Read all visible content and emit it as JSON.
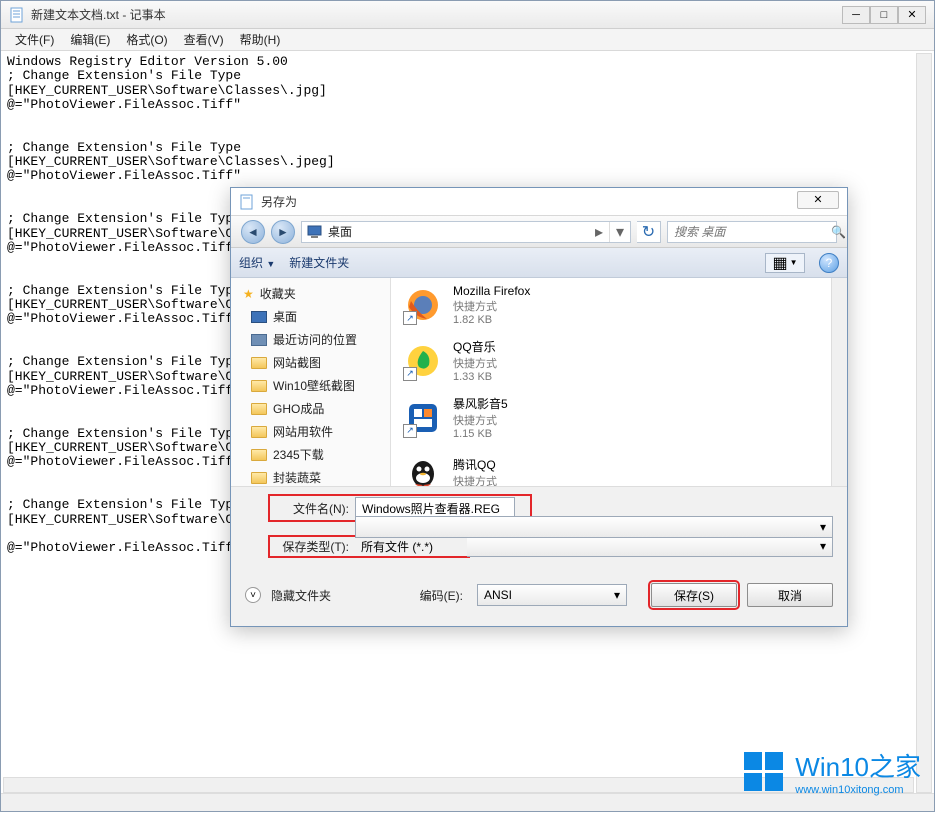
{
  "notepad": {
    "title": "新建文本文档.txt - 记事本",
    "menu": {
      "file": "文件(F)",
      "edit": "编辑(E)",
      "format": "格式(O)",
      "view": "查看(V)",
      "help": "帮助(H)"
    },
    "content": "Windows Registry Editor Version 5.00\n; Change Extension's File Type\n[HKEY_CURRENT_USER\\Software\\Classes\\.jpg]\n@=\"PhotoViewer.FileAssoc.Tiff\"\n\n\n; Change Extension's File Type\n[HKEY_CURRENT_USER\\Software\\Classes\\.jpeg]\n@=\"PhotoViewer.FileAssoc.Tiff\"\n\n\n; Change Extension's File Type\n[HKEY_CURRENT_USER\\Software\\C\n@=\"PhotoViewer.FileAssoc.Tiff\n\n\n; Change Extension's File Type\n[HKEY_CURRENT_USER\\Software\\C\n@=\"PhotoViewer.FileAssoc.Tiff\n\n\n; Change Extension's File Type\n[HKEY_CURRENT_USER\\Software\\C\n@=\"PhotoViewer.FileAssoc.Tiff\n\n\n; Change Extension's File Type\n[HKEY_CURRENT_USER\\Software\\C\n@=\"PhotoViewer.FileAssoc.Tiff\n\n\n; Change Extension's File Type\n[HKEY_CURRENT_USER\\Software\\C\n\n@=\"PhotoViewer.FileAssoc.Tiff"
  },
  "dialog": {
    "title": "另存为",
    "location": "桌面",
    "search_placeholder": "搜索 桌面",
    "organize": "组织",
    "new_folder": "新建文件夹",
    "sidebar": {
      "favorites": "收藏夹",
      "items": [
        "桌面",
        "最近访问的位置",
        "网站截图",
        "Win10壁纸截图",
        "GHO成品",
        "网站用软件",
        "2345下载",
        "封装蔬菜"
      ]
    },
    "files": [
      {
        "name": "Mozilla Firefox",
        "type": "快捷方式",
        "size": "1.82 KB",
        "icon": "firefox"
      },
      {
        "name": "QQ音乐",
        "type": "快捷方式",
        "size": "1.33 KB",
        "icon": "qqmusic"
      },
      {
        "name": "暴风影音5",
        "type": "快捷方式",
        "size": "1.15 KB",
        "icon": "baofeng"
      },
      {
        "name": "腾讯QQ",
        "type": "快捷方式",
        "size": "",
        "icon": "qq"
      }
    ],
    "filename_label": "文件名(N):",
    "filename_value": "Windows照片查看器.REG",
    "filetype_label": "保存类型(T):",
    "filetype_value": "所有文件 (*.*)",
    "hide_folders": "隐藏文件夹",
    "encoding_label": "编码(E):",
    "encoding_value": "ANSI",
    "save_btn": "保存(S)",
    "cancel_btn": "取消"
  },
  "watermark": {
    "brand": "Win10之家",
    "url": "www.win10xitong.com"
  }
}
